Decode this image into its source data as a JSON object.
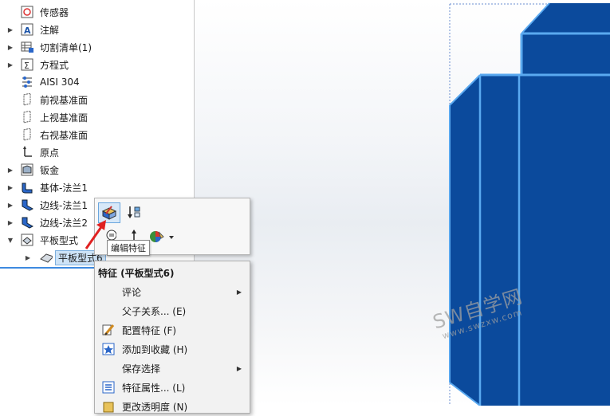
{
  "tree": {
    "items": [
      {
        "label": "传感器",
        "icon": "sensor-icon",
        "expandable": false
      },
      {
        "label": "注解",
        "icon": "annotation-icon",
        "expandable": true
      },
      {
        "label": "切割清单(1)",
        "icon": "cut-list-icon",
        "expandable": true
      },
      {
        "label": "方程式",
        "icon": "equation-icon",
        "expandable": true
      },
      {
        "label": "AISI 304",
        "icon": "material-icon",
        "expandable": false
      },
      {
        "label": "前视基准面",
        "icon": "plane-icon",
        "expandable": false
      },
      {
        "label": "上视基准面",
        "icon": "plane-icon",
        "expandable": false
      },
      {
        "label": "右视基准面",
        "icon": "plane-icon",
        "expandable": false
      },
      {
        "label": "原点",
        "icon": "origin-icon",
        "expandable": false
      },
      {
        "label": "钣金",
        "icon": "sheet-metal-icon",
        "expandable": true
      },
      {
        "label": "基体-法兰1",
        "icon": "base-flange-icon",
        "expandable": true
      },
      {
        "label": "边线-法兰1",
        "icon": "edge-flange-icon",
        "expandable": true
      },
      {
        "label": "边线-法兰2",
        "icon": "edge-flange-icon",
        "expandable": true
      },
      {
        "label": "平板型式",
        "icon": "flat-pattern-icon",
        "expandable": true
      },
      {
        "label": "平板型式6",
        "icon": "flat-pattern-feature-icon",
        "expandable": true
      }
    ]
  },
  "toolbar": {
    "edit_feature_tooltip": "编辑特征"
  },
  "context_menu": {
    "header": "特征 (平板型式6)",
    "items": [
      {
        "label": "评论",
        "submenu": true,
        "icon": ""
      },
      {
        "label": "父子关系... (E)",
        "submenu": false,
        "icon": ""
      },
      {
        "label": "配置特征 (F)",
        "submenu": false,
        "icon": "configure-feature-icon"
      },
      {
        "label": "添加到收藏 (H)",
        "submenu": false,
        "icon": "favorite-icon"
      },
      {
        "label": "保存选择",
        "submenu": true,
        "icon": ""
      },
      {
        "label": "特征属性... (L)",
        "submenu": false,
        "icon": "feature-properties-icon"
      },
      {
        "label": "更改透明度 (N)",
        "submenu": false,
        "icon": "transparency-icon"
      }
    ]
  },
  "watermark": {
    "main": "SW自学网",
    "sub": "www.swzxw.com"
  },
  "colors": {
    "part_fill": "#0b4a9c",
    "part_edge": "#5aa9f0",
    "selection": "#cde3f7"
  }
}
